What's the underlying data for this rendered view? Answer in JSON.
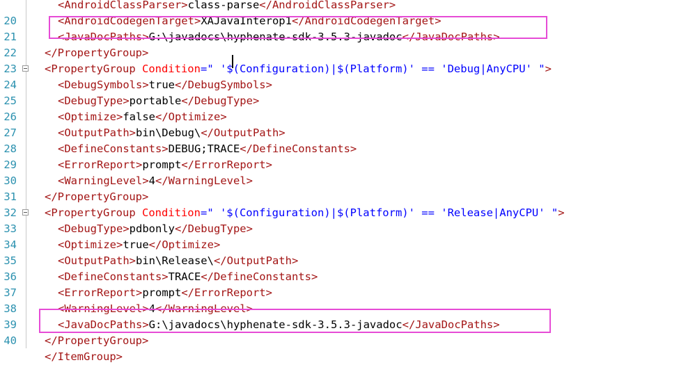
{
  "lines": [
    {
      "num": "",
      "indent": 1,
      "frag": [
        {
          "c": "tn",
          "t": "<AndroidClassParser>"
        },
        {
          "c": "tx",
          "t": "class-parse"
        },
        {
          "c": "tn",
          "t": "</AndroidClassParser>"
        }
      ]
    },
    {
      "num": "20",
      "indent": 1,
      "frag": [
        {
          "c": "tn",
          "t": "<AndroidCodegenTarget>"
        },
        {
          "c": "tx",
          "t": "XAJavaInterop1"
        },
        {
          "c": "tn",
          "t": "</AndroidCodegenTarget>"
        }
      ]
    },
    {
      "num": "21",
      "indent": 1,
      "frag": [
        {
          "c": "tn",
          "t": "<JavaDocPaths>"
        },
        {
          "c": "tx",
          "t": "G:\\javadocs\\hyphenate-sdk-3.5.3-javadoc"
        },
        {
          "c": "tn",
          "t": "</JavaDocPaths>"
        }
      ]
    },
    {
      "num": "22",
      "indent": 0,
      "frag": [
        {
          "c": "tn",
          "t": "</PropertyGroup>"
        }
      ]
    },
    {
      "num": "23",
      "indent": 0,
      "fold": true,
      "frag": [
        {
          "c": "tn",
          "t": "<PropertyGroup "
        },
        {
          "c": "an",
          "t": "Condition"
        },
        {
          "c": "av",
          "t": "=\" '$(Configuration)|$(Platform)' == 'Debug|AnyCPU' \""
        },
        {
          "c": "tn",
          "t": ">"
        }
      ]
    },
    {
      "num": "24",
      "indent": 1,
      "frag": [
        {
          "c": "tn",
          "t": "<DebugSymbols>"
        },
        {
          "c": "tx",
          "t": "true"
        },
        {
          "c": "tn",
          "t": "</DebugSymbols>"
        }
      ]
    },
    {
      "num": "25",
      "indent": 1,
      "frag": [
        {
          "c": "tn",
          "t": "<DebugType>"
        },
        {
          "c": "tx",
          "t": "portable"
        },
        {
          "c": "tn",
          "t": "</DebugType>"
        }
      ]
    },
    {
      "num": "26",
      "indent": 1,
      "frag": [
        {
          "c": "tn",
          "t": "<Optimize>"
        },
        {
          "c": "tx",
          "t": "false"
        },
        {
          "c": "tn",
          "t": "</Optimize>"
        }
      ]
    },
    {
      "num": "27",
      "indent": 1,
      "frag": [
        {
          "c": "tn",
          "t": "<OutputPath>"
        },
        {
          "c": "tx",
          "t": "bin\\Debug\\"
        },
        {
          "c": "tn",
          "t": "</OutputPath>"
        }
      ]
    },
    {
      "num": "28",
      "indent": 1,
      "frag": [
        {
          "c": "tn",
          "t": "<DefineConstants>"
        },
        {
          "c": "tx",
          "t": "DEBUG;TRACE"
        },
        {
          "c": "tn",
          "t": "</DefineConstants>"
        }
      ]
    },
    {
      "num": "29",
      "indent": 1,
      "frag": [
        {
          "c": "tn",
          "t": "<ErrorReport>"
        },
        {
          "c": "tx",
          "t": "prompt"
        },
        {
          "c": "tn",
          "t": "</ErrorReport>"
        }
      ]
    },
    {
      "num": "30",
      "indent": 1,
      "frag": [
        {
          "c": "tn",
          "t": "<WarningLevel>"
        },
        {
          "c": "tx",
          "t": "4"
        },
        {
          "c": "tn",
          "t": "</WarningLevel>"
        }
      ]
    },
    {
      "num": "31",
      "indent": 0,
      "frag": [
        {
          "c": "tn",
          "t": "</PropertyGroup>"
        }
      ]
    },
    {
      "num": "32",
      "indent": 0,
      "fold": true,
      "frag": [
        {
          "c": "tn",
          "t": "<PropertyGroup "
        },
        {
          "c": "an",
          "t": "Condition"
        },
        {
          "c": "av",
          "t": "=\" '$(Configuration)|$(Platform)' == 'Release|AnyCPU' \""
        },
        {
          "c": "tn",
          "t": ">"
        }
      ]
    },
    {
      "num": "33",
      "indent": 1,
      "frag": [
        {
          "c": "tn",
          "t": "<DebugType>"
        },
        {
          "c": "tx",
          "t": "pdbonly"
        },
        {
          "c": "tn",
          "t": "</DebugType>"
        }
      ]
    },
    {
      "num": "34",
      "indent": 1,
      "frag": [
        {
          "c": "tn",
          "t": "<Optimize>"
        },
        {
          "c": "tx",
          "t": "true"
        },
        {
          "c": "tn",
          "t": "</Optimize>"
        }
      ]
    },
    {
      "num": "35",
      "indent": 1,
      "frag": [
        {
          "c": "tn",
          "t": "<OutputPath>"
        },
        {
          "c": "tx",
          "t": "bin\\Release\\"
        },
        {
          "c": "tn",
          "t": "</OutputPath>"
        }
      ]
    },
    {
      "num": "36",
      "indent": 1,
      "frag": [
        {
          "c": "tn",
          "t": "<DefineConstants>"
        },
        {
          "c": "tx",
          "t": "TRACE"
        },
        {
          "c": "tn",
          "t": "</DefineConstants>"
        }
      ]
    },
    {
      "num": "37",
      "indent": 1,
      "frag": [
        {
          "c": "tn",
          "t": "<ErrorReport>"
        },
        {
          "c": "tx",
          "t": "prompt"
        },
        {
          "c": "tn",
          "t": "</ErrorReport>"
        }
      ]
    },
    {
      "num": "38",
      "indent": 1,
      "frag": [
        {
          "c": "tn",
          "t": "<WarningLevel>"
        },
        {
          "c": "tx",
          "t": "4"
        },
        {
          "c": "tn",
          "t": "</WarningLevel>"
        }
      ]
    },
    {
      "num": "39",
      "indent": 1,
      "frag": [
        {
          "c": "tn",
          "t": "<JavaDocPaths>"
        },
        {
          "c": "tx",
          "t": "G:\\javadocs\\hyphenate-sdk-3.5.3-javadoc"
        },
        {
          "c": "tn",
          "t": "</JavaDocPaths>"
        }
      ]
    },
    {
      "num": "40",
      "indent": 0,
      "frag": [
        {
          "c": "tn",
          "t": "</PropertyGroup>"
        }
      ]
    },
    {
      "num": "",
      "indent": 0,
      "frag": [
        {
          "c": "tn",
          "t": "</ItemGroup>"
        }
      ]
    }
  ],
  "colors": {
    "highlight": "#e64bd6",
    "tag": "#a31515",
    "attr_name": "#ff0000",
    "attr_value": "#0000ff",
    "line_number": "#2b91af"
  }
}
